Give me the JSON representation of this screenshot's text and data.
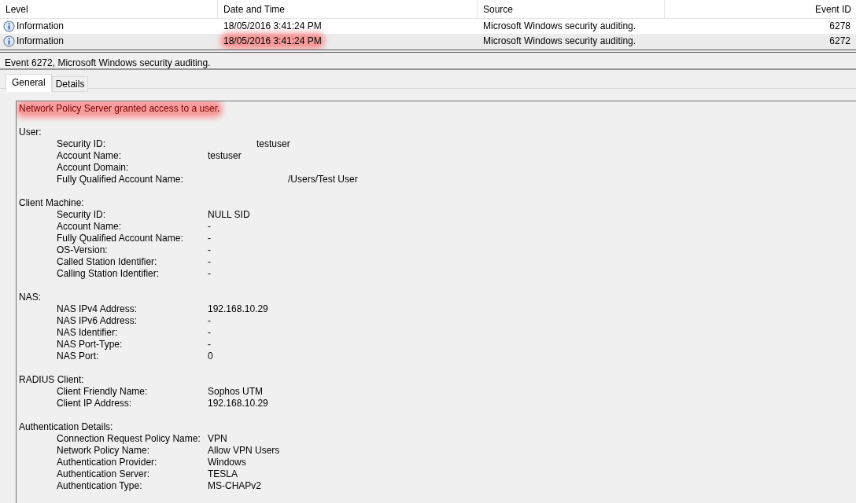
{
  "event_list": {
    "columns": [
      {
        "label": "Level"
      },
      {
        "label": "Date and Time"
      },
      {
        "label": "Source"
      },
      {
        "label": "Event ID"
      }
    ],
    "rows": [
      {
        "level": "Information",
        "date": "18/05/2016 3:41:24 PM",
        "date_highlighted": false,
        "source": "Microsoft Windows security auditing.",
        "event_id": "6278",
        "selected": false
      },
      {
        "level": "Information",
        "date": "18/05/2016 3:41:24 PM",
        "date_highlighted": true,
        "source": "Microsoft Windows security auditing.",
        "event_id": "6272",
        "selected": true
      }
    ]
  },
  "detail_title": "Event 6272, Microsoft Windows security auditing.",
  "tabs": [
    {
      "label": "General",
      "selected": true
    },
    {
      "label": "Details",
      "selected": false
    }
  ],
  "message": {
    "headline": "Network Policy Server granted access to a user.",
    "headline_highlighted": true,
    "sections": [
      {
        "title": "User:",
        "fields": [
          {
            "label": "Security ID:",
            "value": "testuser",
            "kind": "shifted"
          },
          {
            "label": "Account Name:",
            "value": "testuser",
            "kind": "plain"
          },
          {
            "label": "Account Domain:",
            "kind": "plain"
          },
          {
            "label": "Fully Qualified Account Name:",
            "value": "/Users/Test User",
            "kind": "farshifted"
          }
        ]
      },
      {
        "title": "Client Machine:",
        "fields": [
          {
            "label": "Security ID:",
            "value": "NULL SID",
            "kind": "plain"
          },
          {
            "label": "Account Name:",
            "value": "-",
            "kind": "plain"
          },
          {
            "label": "Fully Qualified Account Name:",
            "value": "-",
            "kind": "plain"
          },
          {
            "label": "OS-Version:",
            "value": "-",
            "kind": "plain"
          },
          {
            "label": "Called Station Identifier:",
            "value": "-",
            "kind": "plain"
          },
          {
            "label": "Calling Station Identifier:",
            "value": "-",
            "kind": "plain"
          }
        ]
      },
      {
        "title": "NAS:",
        "fields": [
          {
            "label": "NAS IPv4 Address:",
            "value": "192.168.10.29",
            "kind": "plain"
          },
          {
            "label": "NAS IPv6 Address:",
            "value": "-",
            "kind": "plain"
          },
          {
            "label": "NAS Identifier:",
            "value": "-",
            "kind": "plain"
          },
          {
            "label": "NAS Port-Type:",
            "value": "-",
            "kind": "plain"
          },
          {
            "label": "NAS Port:",
            "value": "0",
            "kind": "plain"
          }
        ]
      },
      {
        "title": "RADIUS Client:",
        "fields": [
          {
            "label": "Client Friendly Name:",
            "value": "Sophos UTM",
            "kind": "plain"
          },
          {
            "label": "Client IP Address:",
            "value": "192.168.10.29",
            "kind": "plain"
          }
        ]
      },
      {
        "title": "Authentication Details:",
        "fields": [
          {
            "label": "Connection Request Policy Name:",
            "value": "VPN",
            "kind": "plain"
          },
          {
            "label": "Network Policy Name:",
            "value": "Allow VPN Users",
            "kind": "plain"
          },
          {
            "label": "Authentication Provider:",
            "value": "Windows",
            "kind": "plain"
          },
          {
            "label": "Authentication Server:",
            "value": "TESLA",
            "kind": "plain"
          },
          {
            "label": "Authentication Type:",
            "value": "MS-CHAPv2",
            "kind": "plain"
          }
        ]
      }
    ]
  }
}
